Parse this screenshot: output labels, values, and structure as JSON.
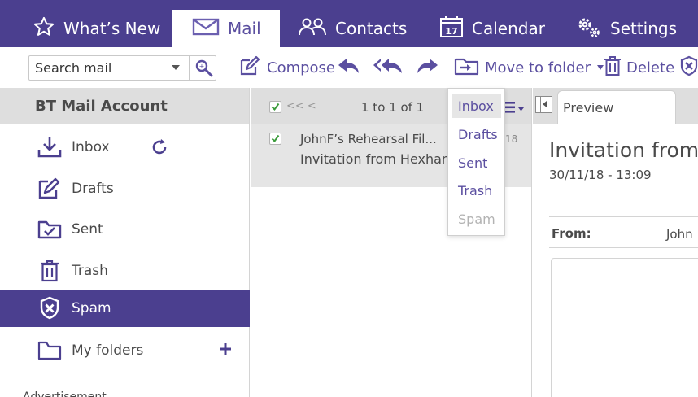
{
  "nav": {
    "tabs": [
      {
        "label": "What’s New",
        "icon": "star-icon"
      },
      {
        "label": "Mail",
        "icon": "envelope-icon",
        "active": true
      },
      {
        "label": "Contacts",
        "icon": "contacts-icon"
      },
      {
        "label": "Calendar",
        "icon": "calendar-icon",
        "day": "17"
      },
      {
        "label": "Settings",
        "icon": "gears-icon"
      }
    ]
  },
  "toolbar": {
    "search_placeholder": "Search mail",
    "compose_label": "Compose",
    "move_label": "Move to folder",
    "delete_label": "Delete"
  },
  "sidebar": {
    "account": "BT Mail Account",
    "folders": [
      {
        "label": "Inbox",
        "icon": "inbox-tray-icon"
      },
      {
        "label": "Drafts",
        "icon": "drafts-icon"
      },
      {
        "label": "Sent",
        "icon": "sent-folder-icon"
      },
      {
        "label": "Trash",
        "icon": "trash-icon"
      },
      {
        "label": "Spam",
        "icon": "spam-shield-icon",
        "active": true
      },
      {
        "label": "My folders",
        "icon": "folder-icon"
      }
    ],
    "more_label": "Advertisement"
  },
  "message_list": {
    "pager_prev": "<< <",
    "pager_count": "1 to 1 of 1",
    "messages": [
      {
        "sender": "JohnF’s Rehearsal Fil...",
        "subject": "Invitation from Hexham",
        "date": "18",
        "checked": true
      }
    ]
  },
  "move_menu": {
    "items": [
      {
        "label": "Inbox",
        "highlighted": true
      },
      {
        "label": "Drafts"
      },
      {
        "label": "Sent"
      },
      {
        "label": "Trash"
      },
      {
        "label": "Spam",
        "disabled": true
      }
    ]
  },
  "preview": {
    "tab_label": "Preview",
    "subject": "Invitation from",
    "date": "30/11/18 - 13:09",
    "from_label": "From:",
    "from_value": "John"
  },
  "colors": {
    "brand": "#4b3f8f",
    "accent_text": "#5b4fa0",
    "check": "#3a9b3a"
  }
}
